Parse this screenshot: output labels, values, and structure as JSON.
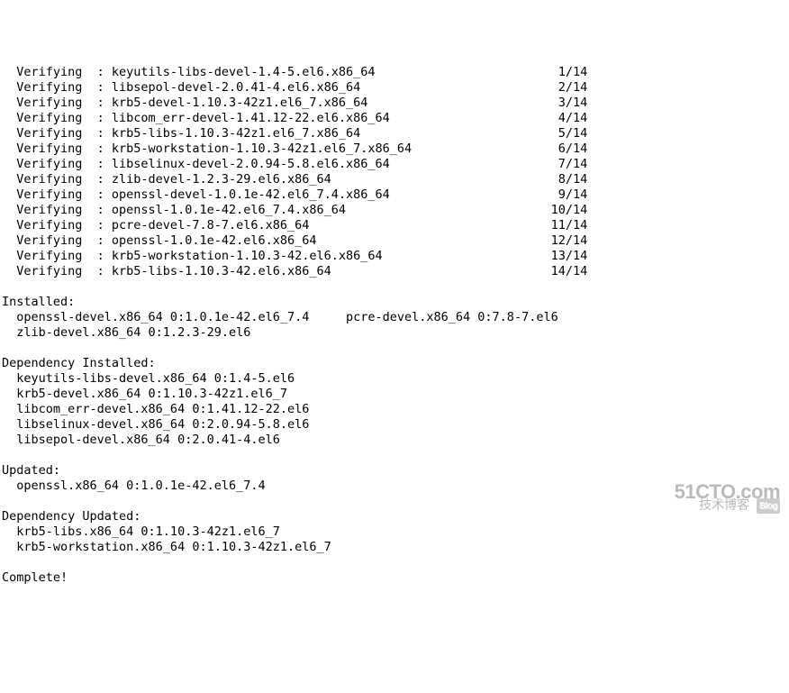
{
  "verify_label": "  Verifying  : ",
  "verify_rows": [
    {
      "pkg": "keyutils-libs-devel-1.4-5.el6.x86_64",
      "count": " 1/14"
    },
    {
      "pkg": "libsepol-devel-2.0.41-4.el6.x86_64",
      "count": " 2/14"
    },
    {
      "pkg": "krb5-devel-1.10.3-42z1.el6_7.x86_64",
      "count": " 3/14"
    },
    {
      "pkg": "libcom_err-devel-1.41.12-22.el6.x86_64",
      "count": " 4/14"
    },
    {
      "pkg": "krb5-libs-1.10.3-42z1.el6_7.x86_64",
      "count": " 5/14"
    },
    {
      "pkg": "krb5-workstation-1.10.3-42z1.el6_7.x86_64",
      "count": " 6/14"
    },
    {
      "pkg": "libselinux-devel-2.0.94-5.8.el6.x86_64",
      "count": " 7/14"
    },
    {
      "pkg": "zlib-devel-1.2.3-29.el6.x86_64",
      "count": " 8/14"
    },
    {
      "pkg": "openssl-devel-1.0.1e-42.el6_7.4.x86_64",
      "count": " 9/14"
    },
    {
      "pkg": "openssl-1.0.1e-42.el6_7.4.x86_64",
      "count": "10/14"
    },
    {
      "pkg": "pcre-devel-7.8-7.el6.x86_64",
      "count": "11/14"
    },
    {
      "pkg": "openssl-1.0.1e-42.el6.x86_64",
      "count": "12/14"
    },
    {
      "pkg": "krb5-workstation-1.10.3-42.el6.x86_64",
      "count": "13/14"
    },
    {
      "pkg": "krb5-libs-1.10.3-42.el6.x86_64",
      "count": "14/14"
    }
  ],
  "sections": {
    "installed_header": "Installed:",
    "installed_line1": "  openssl-devel.x86_64 0:1.0.1e-42.el6_7.4     pcre-devel.x86_64 0:7.8-7.el6",
    "installed_line2": "  zlib-devel.x86_64 0:1.2.3-29.el6",
    "dep_installed_header": "Dependency Installed:",
    "dep_installed_1": "  keyutils-libs-devel.x86_64 0:1.4-5.el6",
    "dep_installed_2": "  krb5-devel.x86_64 0:1.10.3-42z1.el6_7",
    "dep_installed_3": "  libcom_err-devel.x86_64 0:1.41.12-22.el6",
    "dep_installed_4": "  libselinux-devel.x86_64 0:2.0.94-5.8.el6",
    "dep_installed_5": "  libsepol-devel.x86_64 0:2.0.41-4.el6",
    "updated_header": "Updated:",
    "updated_1": "  openssl.x86_64 0:1.0.1e-42.el6_7.4",
    "dep_updated_header": "Dependency Updated:",
    "dep_updated_1": "  krb5-libs.x86_64 0:1.10.3-42z1.el6_7",
    "dep_updated_2": "  krb5-workstation.x86_64 0:1.10.3-42z1.el6_7",
    "complete": "Complete!"
  },
  "watermark": {
    "main": "51CTO.com",
    "sub": "技术博客",
    "blog": "Blog"
  },
  "layout": {
    "pkg_width_chars": 60
  }
}
